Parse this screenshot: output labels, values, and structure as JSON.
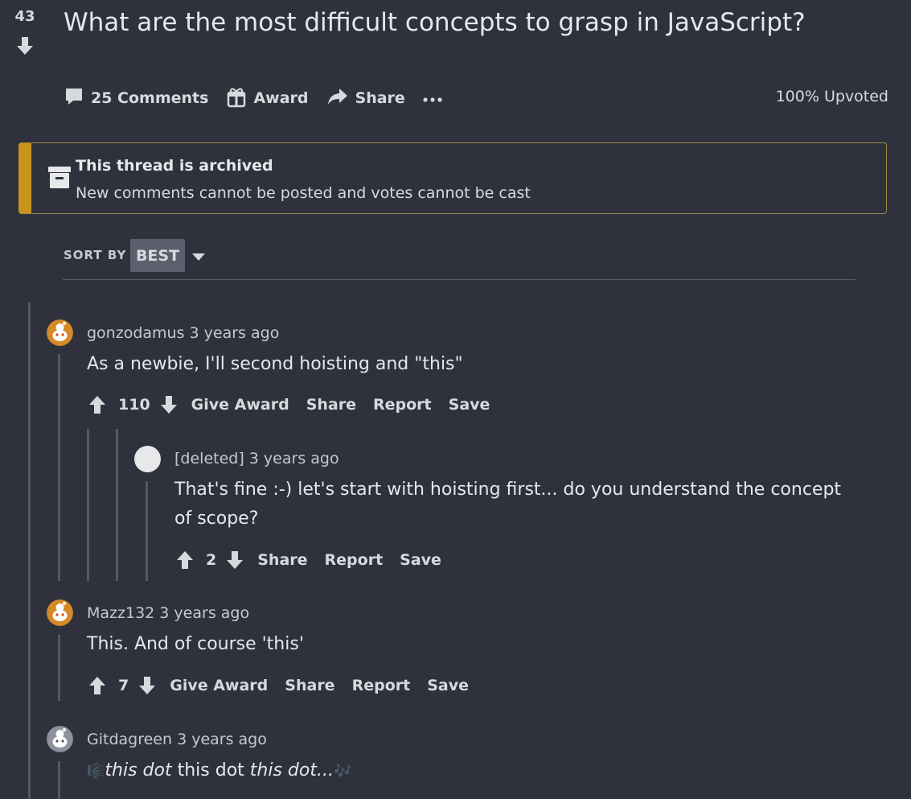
{
  "post": {
    "score": "43",
    "title": "What are the most difficult concepts to grasp in JavaScript?",
    "comments_label": "25 Comments",
    "award_label": "Award",
    "share_label": "Share",
    "upvoted": "100% Upvoted"
  },
  "banner": {
    "title": "This thread is archived",
    "text": "New comments cannot be posted and votes cannot be cast",
    "accent": "#c8951c"
  },
  "sort": {
    "label": "SORT BY",
    "value": "BEST"
  },
  "comments": [
    {
      "author": "gonzodamus",
      "time": "3 years ago",
      "body": "As a newbie, I'll second hoisting and \"this\"",
      "votes": "110",
      "actions": [
        "Give Award",
        "Share",
        "Report",
        "Save"
      ]
    },
    {
      "author": "[deleted]",
      "time": "3 years ago",
      "body_line1": "That's fine :-) let's start with hoisting first... do you understand the concept",
      "body_line2": "of scope?",
      "votes": "2",
      "actions": [
        "Share",
        "Report",
        "Save"
      ]
    },
    {
      "author": "Mazz132",
      "time": "3 years ago",
      "body": "This. And of course 'this'",
      "votes": "7",
      "actions": [
        "Give Award",
        "Share",
        "Report",
        "Save"
      ]
    },
    {
      "author": "Gitdagreen",
      "time": "3 years ago",
      "body_em1": "this dot",
      "body_mid": " this dot ",
      "body_em2": "this dot...",
      "emoji_left": "🎼",
      "emoji_right": "🎶"
    }
  ],
  "colors": {
    "background": "#2f323d",
    "text": "#d7dadc",
    "thread_line": "#555863",
    "avatar_orange": "#d68a27"
  },
  "icons": [
    "downvote-arrow-icon",
    "comment-icon",
    "gift-icon",
    "share-arrow-icon",
    "more-dots-icon",
    "archive-box-icon",
    "caret-down-icon",
    "upvote-arrow-icon",
    "snoo-avatar-icon"
  ]
}
